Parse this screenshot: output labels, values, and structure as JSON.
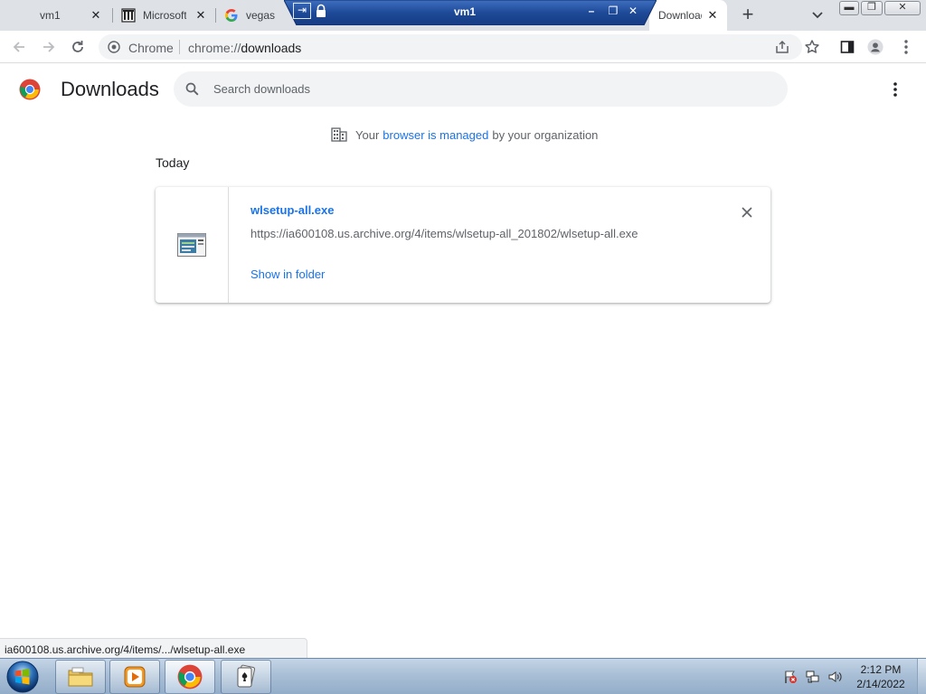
{
  "tabs": [
    {
      "title": "vm1"
    },
    {
      "title": "Microsoft"
    },
    {
      "title": "vegas"
    },
    {
      "title": "Downloads"
    }
  ],
  "rdp": {
    "title": "vm1"
  },
  "omnibox": {
    "site_label": "Chrome",
    "scheme": "chrome://",
    "host": "downloads"
  },
  "page": {
    "title": "Downloads",
    "search_placeholder": "Search downloads",
    "managed_prefix": "Your",
    "managed_link": "browser is managed",
    "managed_suffix": "by your organization",
    "date_header": "Today"
  },
  "downloads": [
    {
      "file_name": "wlsetup-all.exe",
      "url": "https://ia600108.us.archive.org/4/items/wlsetup-all_201802/wlsetup-all.exe",
      "action": "Show in folder"
    }
  ],
  "status_bubble": "ia600108.us.archive.org/4/items/.../wlsetup-all.exe",
  "taskbar": {
    "time": "2:12 PM",
    "date": "2/14/2022"
  },
  "colors": {
    "link": "#1a73e8",
    "tabstrip": "#dee1e6",
    "omnibox": "#f1f3f4",
    "rdp_bar": "#1e4a98"
  }
}
